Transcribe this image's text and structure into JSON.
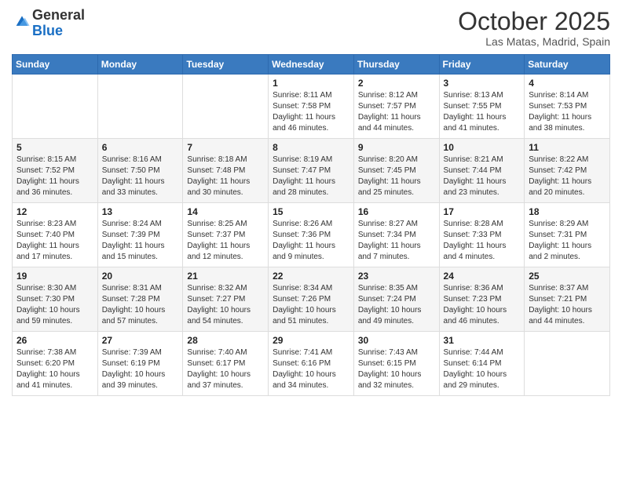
{
  "header": {
    "logo_general": "General",
    "logo_blue": "Blue",
    "month_title": "October 2025",
    "location": "Las Matas, Madrid, Spain"
  },
  "days_of_week": [
    "Sunday",
    "Monday",
    "Tuesday",
    "Wednesday",
    "Thursday",
    "Friday",
    "Saturday"
  ],
  "weeks": [
    [
      {
        "day": "",
        "sunrise": "",
        "sunset": "",
        "daylight": ""
      },
      {
        "day": "",
        "sunrise": "",
        "sunset": "",
        "daylight": ""
      },
      {
        "day": "",
        "sunrise": "",
        "sunset": "",
        "daylight": ""
      },
      {
        "day": "1",
        "sunrise": "Sunrise: 8:11 AM",
        "sunset": "Sunset: 7:58 PM",
        "daylight": "Daylight: 11 hours and 46 minutes."
      },
      {
        "day": "2",
        "sunrise": "Sunrise: 8:12 AM",
        "sunset": "Sunset: 7:57 PM",
        "daylight": "Daylight: 11 hours and 44 minutes."
      },
      {
        "day": "3",
        "sunrise": "Sunrise: 8:13 AM",
        "sunset": "Sunset: 7:55 PM",
        "daylight": "Daylight: 11 hours and 41 minutes."
      },
      {
        "day": "4",
        "sunrise": "Sunrise: 8:14 AM",
        "sunset": "Sunset: 7:53 PM",
        "daylight": "Daylight: 11 hours and 38 minutes."
      }
    ],
    [
      {
        "day": "5",
        "sunrise": "Sunrise: 8:15 AM",
        "sunset": "Sunset: 7:52 PM",
        "daylight": "Daylight: 11 hours and 36 minutes."
      },
      {
        "day": "6",
        "sunrise": "Sunrise: 8:16 AM",
        "sunset": "Sunset: 7:50 PM",
        "daylight": "Daylight: 11 hours and 33 minutes."
      },
      {
        "day": "7",
        "sunrise": "Sunrise: 8:18 AM",
        "sunset": "Sunset: 7:48 PM",
        "daylight": "Daylight: 11 hours and 30 minutes."
      },
      {
        "day": "8",
        "sunrise": "Sunrise: 8:19 AM",
        "sunset": "Sunset: 7:47 PM",
        "daylight": "Daylight: 11 hours and 28 minutes."
      },
      {
        "day": "9",
        "sunrise": "Sunrise: 8:20 AM",
        "sunset": "Sunset: 7:45 PM",
        "daylight": "Daylight: 11 hours and 25 minutes."
      },
      {
        "day": "10",
        "sunrise": "Sunrise: 8:21 AM",
        "sunset": "Sunset: 7:44 PM",
        "daylight": "Daylight: 11 hours and 23 minutes."
      },
      {
        "day": "11",
        "sunrise": "Sunrise: 8:22 AM",
        "sunset": "Sunset: 7:42 PM",
        "daylight": "Daylight: 11 hours and 20 minutes."
      }
    ],
    [
      {
        "day": "12",
        "sunrise": "Sunrise: 8:23 AM",
        "sunset": "Sunset: 7:40 PM",
        "daylight": "Daylight: 11 hours and 17 minutes."
      },
      {
        "day": "13",
        "sunrise": "Sunrise: 8:24 AM",
        "sunset": "Sunset: 7:39 PM",
        "daylight": "Daylight: 11 hours and 15 minutes."
      },
      {
        "day": "14",
        "sunrise": "Sunrise: 8:25 AM",
        "sunset": "Sunset: 7:37 PM",
        "daylight": "Daylight: 11 hours and 12 minutes."
      },
      {
        "day": "15",
        "sunrise": "Sunrise: 8:26 AM",
        "sunset": "Sunset: 7:36 PM",
        "daylight": "Daylight: 11 hours and 9 minutes."
      },
      {
        "day": "16",
        "sunrise": "Sunrise: 8:27 AM",
        "sunset": "Sunset: 7:34 PM",
        "daylight": "Daylight: 11 hours and 7 minutes."
      },
      {
        "day": "17",
        "sunrise": "Sunrise: 8:28 AM",
        "sunset": "Sunset: 7:33 PM",
        "daylight": "Daylight: 11 hours and 4 minutes."
      },
      {
        "day": "18",
        "sunrise": "Sunrise: 8:29 AM",
        "sunset": "Sunset: 7:31 PM",
        "daylight": "Daylight: 11 hours and 2 minutes."
      }
    ],
    [
      {
        "day": "19",
        "sunrise": "Sunrise: 8:30 AM",
        "sunset": "Sunset: 7:30 PM",
        "daylight": "Daylight: 10 hours and 59 minutes."
      },
      {
        "day": "20",
        "sunrise": "Sunrise: 8:31 AM",
        "sunset": "Sunset: 7:28 PM",
        "daylight": "Daylight: 10 hours and 57 minutes."
      },
      {
        "day": "21",
        "sunrise": "Sunrise: 8:32 AM",
        "sunset": "Sunset: 7:27 PM",
        "daylight": "Daylight: 10 hours and 54 minutes."
      },
      {
        "day": "22",
        "sunrise": "Sunrise: 8:34 AM",
        "sunset": "Sunset: 7:26 PM",
        "daylight": "Daylight: 10 hours and 51 minutes."
      },
      {
        "day": "23",
        "sunrise": "Sunrise: 8:35 AM",
        "sunset": "Sunset: 7:24 PM",
        "daylight": "Daylight: 10 hours and 49 minutes."
      },
      {
        "day": "24",
        "sunrise": "Sunrise: 8:36 AM",
        "sunset": "Sunset: 7:23 PM",
        "daylight": "Daylight: 10 hours and 46 minutes."
      },
      {
        "day": "25",
        "sunrise": "Sunrise: 8:37 AM",
        "sunset": "Sunset: 7:21 PM",
        "daylight": "Daylight: 10 hours and 44 minutes."
      }
    ],
    [
      {
        "day": "26",
        "sunrise": "Sunrise: 7:38 AM",
        "sunset": "Sunset: 6:20 PM",
        "daylight": "Daylight: 10 hours and 41 minutes."
      },
      {
        "day": "27",
        "sunrise": "Sunrise: 7:39 AM",
        "sunset": "Sunset: 6:19 PM",
        "daylight": "Daylight: 10 hours and 39 minutes."
      },
      {
        "day": "28",
        "sunrise": "Sunrise: 7:40 AM",
        "sunset": "Sunset: 6:17 PM",
        "daylight": "Daylight: 10 hours and 37 minutes."
      },
      {
        "day": "29",
        "sunrise": "Sunrise: 7:41 AM",
        "sunset": "Sunset: 6:16 PM",
        "daylight": "Daylight: 10 hours and 34 minutes."
      },
      {
        "day": "30",
        "sunrise": "Sunrise: 7:43 AM",
        "sunset": "Sunset: 6:15 PM",
        "daylight": "Daylight: 10 hours and 32 minutes."
      },
      {
        "day": "31",
        "sunrise": "Sunrise: 7:44 AM",
        "sunset": "Sunset: 6:14 PM",
        "daylight": "Daylight: 10 hours and 29 minutes."
      },
      {
        "day": "",
        "sunrise": "",
        "sunset": "",
        "daylight": ""
      }
    ]
  ]
}
